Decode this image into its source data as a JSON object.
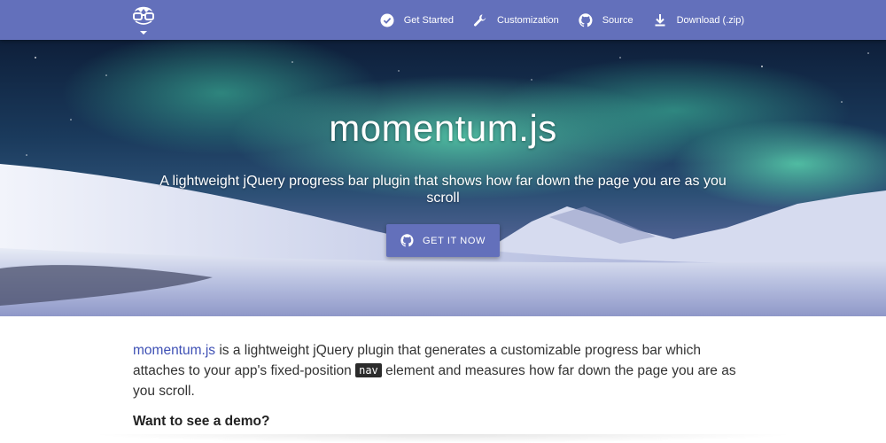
{
  "navbar": {
    "logo_icon": "glasses-face-logo-icon",
    "links": [
      {
        "label": "Get Started",
        "icon": "check-circle-icon"
      },
      {
        "label": "Customization",
        "icon": "wrench-icon"
      },
      {
        "label": "Source",
        "icon": "github-icon"
      },
      {
        "label": "Download (.zip)",
        "icon": "download-icon"
      }
    ],
    "color": "#6370bb"
  },
  "hero": {
    "title": "momentum.js",
    "subtitle": "A lightweight jQuery progress bar plugin that shows how far down the page you are as you scroll",
    "cta_label": "GET IT NOW",
    "cta_icon": "github-icon",
    "background": "aurora-over-snowy-landscape"
  },
  "content": {
    "brand": "momentum.js",
    "intro_part1": " is a lightweight jQuery plugin that generates a customizable progress bar which attaches to your app's fixed-position ",
    "code": "nav",
    "intro_part2": " element and measures how far down the page you are as you scroll.",
    "demo_heading": "Want to see a demo?"
  },
  "colors": {
    "accent": "#6370bb",
    "brand_text": "#3f51b5"
  }
}
